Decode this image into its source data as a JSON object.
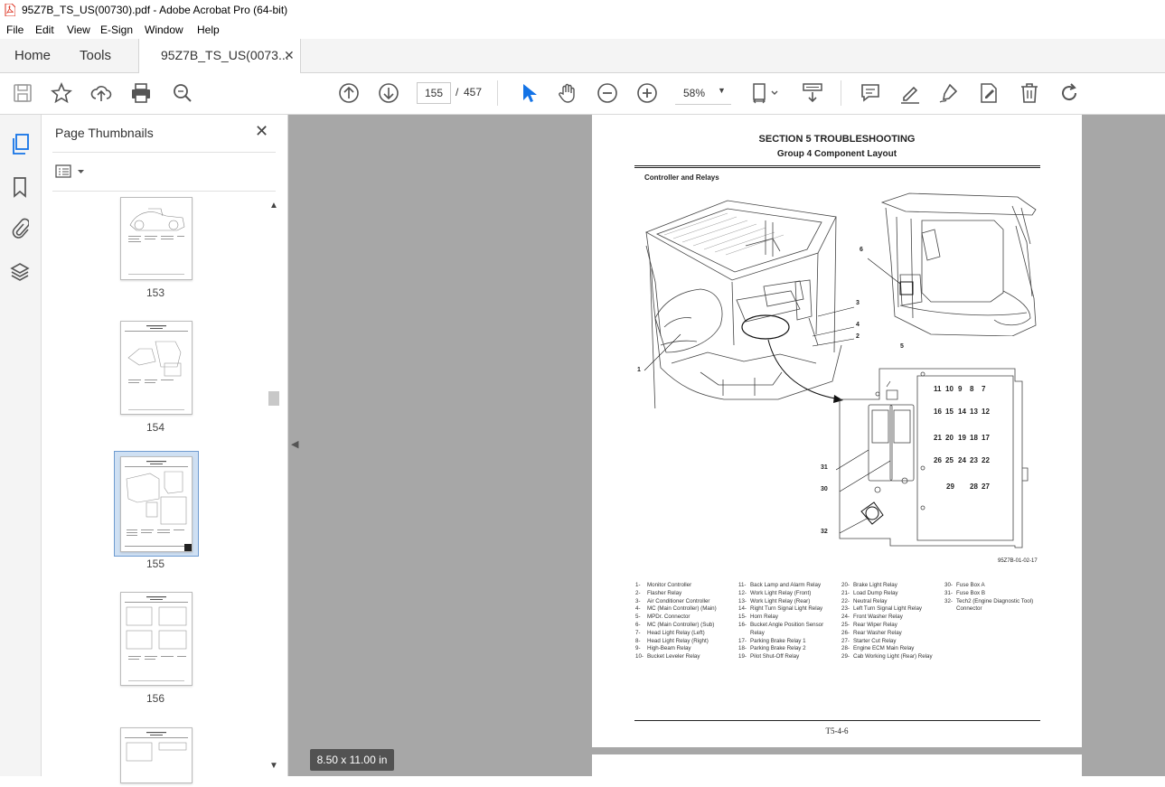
{
  "window": {
    "title": "95Z7B_TS_US(00730).pdf - Adobe Acrobat Pro (64-bit)"
  },
  "menu": [
    "File",
    "Edit",
    "View",
    "E-Sign",
    "Window",
    "Help"
  ],
  "tabs": {
    "home": "Home",
    "tools": "Tools",
    "document": "95Z7B_TS_US(0073..."
  },
  "toolbar": {
    "current_page": "155",
    "page_separator": "/",
    "total_pages": "457",
    "zoom": "58%"
  },
  "panel": {
    "title": "Page Thumbnails",
    "thumbnails": [
      "153",
      "154",
      "155",
      "156"
    ],
    "selected": "155"
  },
  "page": {
    "section": "SECTION 5 TROUBLESHOOTING",
    "group": "Group 4 Component Layout",
    "subtitle": "Controller and Relays",
    "figure_id": "95Z7B-01-02-17",
    "footer": "T5-4-6",
    "callouts": [
      "1",
      "2",
      "3",
      "4",
      "5",
      "6",
      "30",
      "31",
      "32"
    ],
    "fuse_rows": [
      [
        "11",
        "10",
        "9",
        "8",
        "7"
      ],
      [
        "16",
        "15",
        "14",
        "13",
        "12"
      ],
      [
        "21",
        "20",
        "19",
        "18",
        "17"
      ],
      [
        "26",
        "25",
        "24",
        "23",
        "22"
      ],
      [
        "29",
        "28",
        "27"
      ]
    ],
    "legend_col1": [
      [
        "1-",
        "Monitor Controller"
      ],
      [
        "2-",
        "Flasher Relay"
      ],
      [
        "3-",
        "Air Conditioner Controller"
      ],
      [
        "4-",
        "MC (Main Controller) (Main)"
      ],
      [
        "5-",
        "MPDr. Connector"
      ],
      [
        "6-",
        "MC (Main Controller) (Sub)"
      ],
      [
        "7-",
        "Head Light Relay (Left)"
      ],
      [
        "8-",
        "Head Light Relay (Right)"
      ],
      [
        "9-",
        "High-Beam Relay"
      ],
      [
        "10-",
        "Bucket Leveler Relay"
      ]
    ],
    "legend_col2": [
      [
        "11-",
        "Back Lamp and Alarm Relay"
      ],
      [
        "12-",
        "Work Light Relay (Front)"
      ],
      [
        "13-",
        "Work Light Relay (Rear)"
      ],
      [
        "14-",
        "Right Turn Signal Light Relay"
      ],
      [
        "15-",
        "Horn Relay"
      ],
      [
        "16-",
        "Bucket Angle Position Sensor"
      ],
      [
        "",
        "Relay"
      ],
      [
        "17-",
        "Parking Brake Relay 1"
      ],
      [
        "18-",
        "Parking Brake Relay 2"
      ],
      [
        "19-",
        "Pilot Shut-Off Relay"
      ]
    ],
    "legend_col3": [
      [
        "20-",
        "Brake Light Relay"
      ],
      [
        "21-",
        "Load Dump Relay"
      ],
      [
        "22-",
        "Neutral Relay"
      ],
      [
        "23-",
        "Left Turn Signal Light Relay"
      ],
      [
        "24-",
        "Front Washer Relay"
      ],
      [
        "25-",
        "Rear Wiper Relay"
      ],
      [
        "26-",
        "Rear Washer Relay"
      ],
      [
        "27-",
        "Starter Cut Relay"
      ],
      [
        "28-",
        "Engine ECM Main Relay"
      ],
      [
        "29-",
        "Cab Working Light (Rear) Relay"
      ]
    ],
    "legend_col4": [
      [
        "30-",
        "Fuse Box A"
      ],
      [
        "31-",
        "Fuse Box B"
      ],
      [
        "32-",
        "Tech2 (Engine Diagnostic Tool)"
      ],
      [
        "",
        "Connector"
      ]
    ]
  },
  "status": {
    "page_size": "8.50 x 11.00 in"
  }
}
